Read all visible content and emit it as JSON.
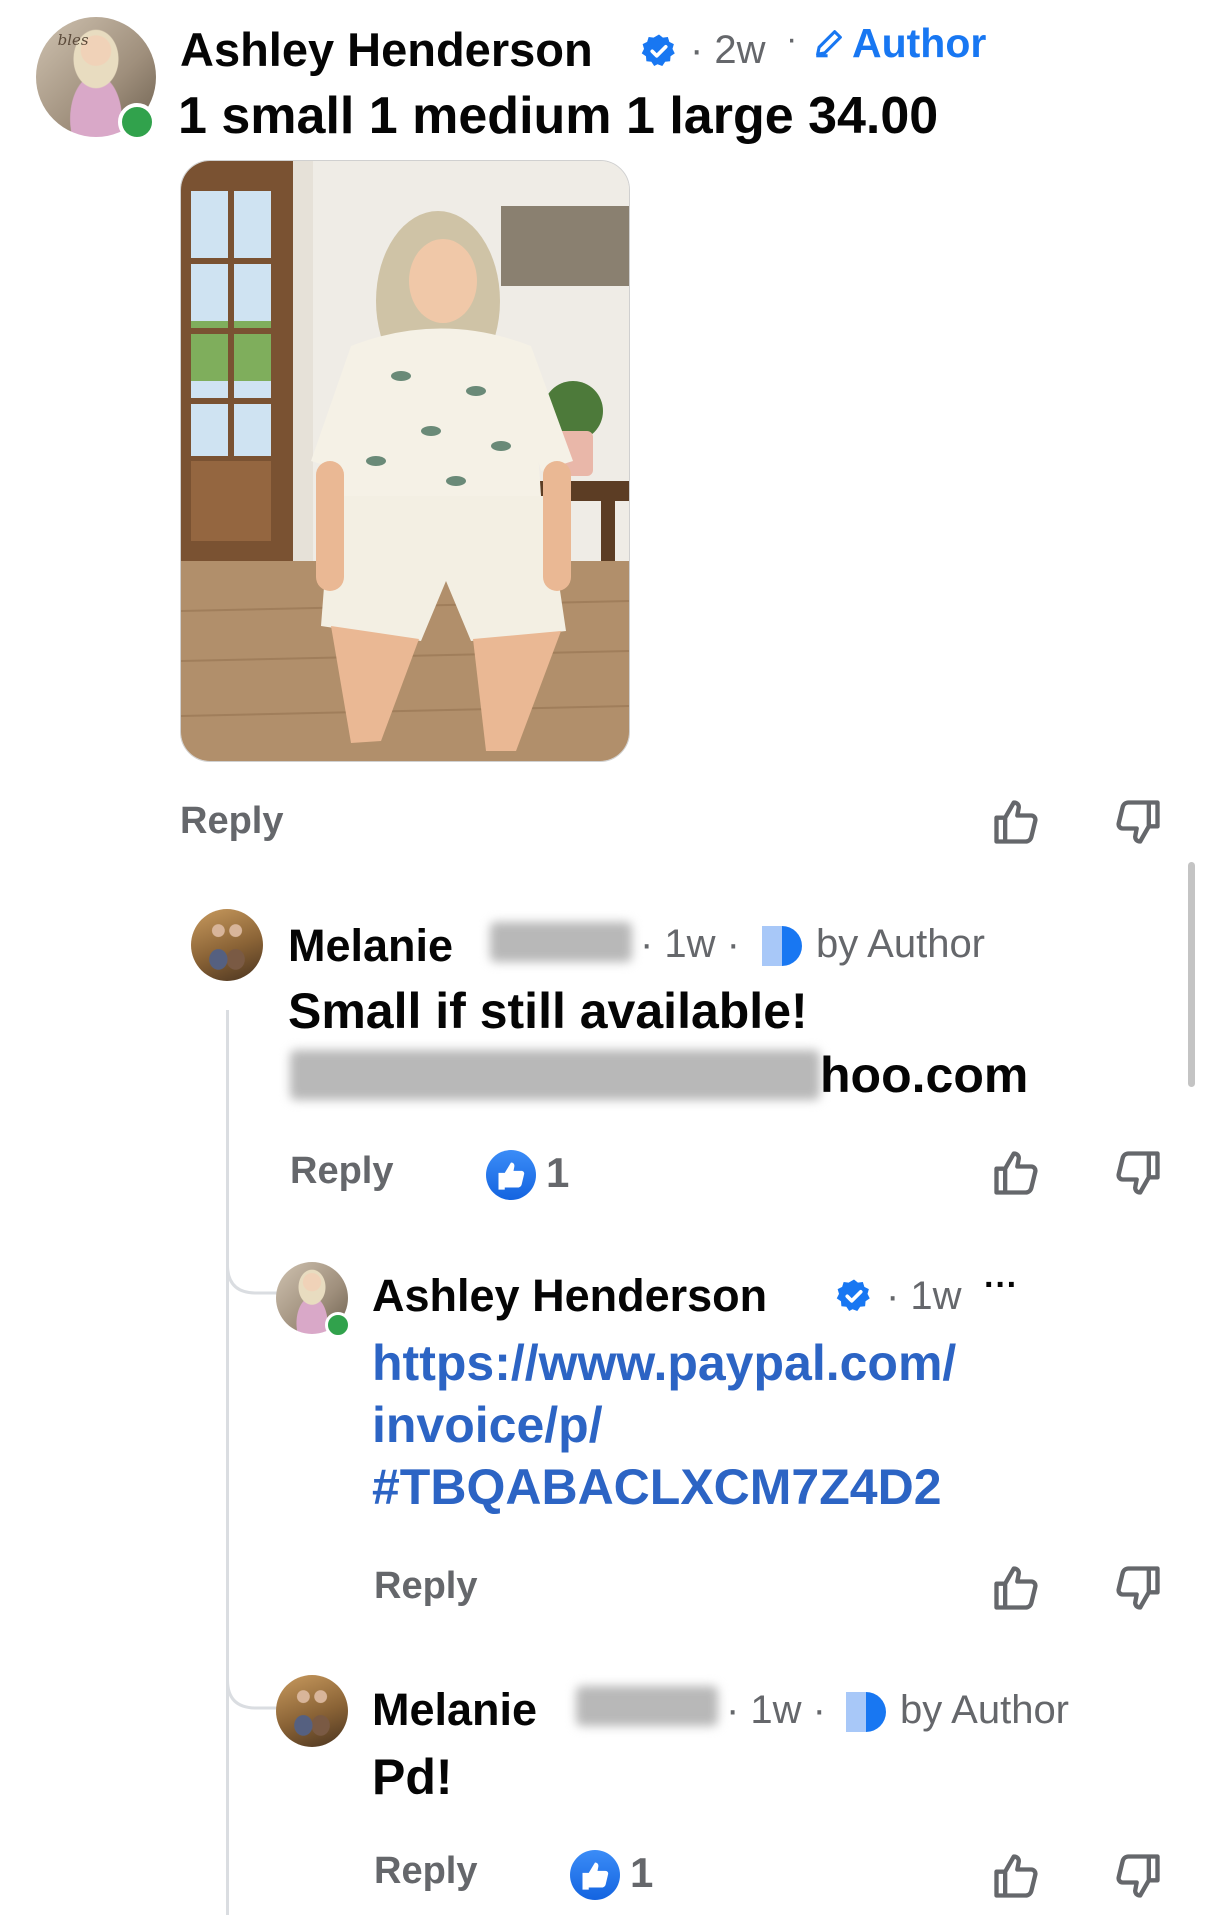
{
  "top_comment": {
    "author": "Ashley Henderson",
    "time": "· 2w",
    "dot": "·",
    "author_tag": "Author",
    "text": "1 small 1 medium 1 large 34.00",
    "avatar_caption": "bles",
    "reply_label": "Reply"
  },
  "reply1": {
    "author": "Melanie",
    "meta": "· 1w ·",
    "liked_by": "by Author",
    "line1": "Small if still available!",
    "line2_visible": "hoo.com",
    "reply_label": "Reply",
    "like_count": "1"
  },
  "reply2": {
    "author": "Ashley Henderson",
    "time": "· 1w",
    "more": "···",
    "link_line1": "https://www.paypal.com/",
    "link_line2": "invoice/p/",
    "link_line3": "#TBQABACLXCM7Z4D2",
    "reply_label": "Reply"
  },
  "reply3": {
    "author": "Melanie",
    "meta": "· 1w ·",
    "liked_by": "by Author",
    "text": "Pd!",
    "reply_label": "Reply",
    "like_count": "1"
  },
  "colors": {
    "link_blue": "#2c64c4",
    "verified_blue": "#1877f2",
    "online_green": "#31a24c",
    "meta_gray": "#65676b"
  }
}
